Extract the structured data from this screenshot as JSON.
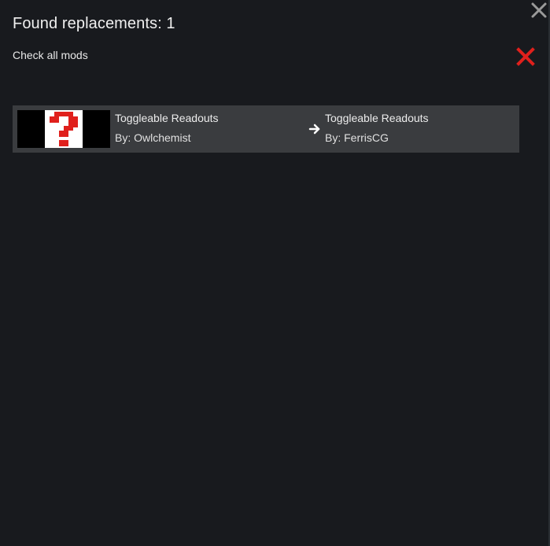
{
  "dialog": {
    "title": "Found replacements: 1",
    "check_all_label": "Check all mods",
    "close_icon": "close-icon",
    "remove_icon": "red-x-icon"
  },
  "replacements": [
    {
      "thumbnail_icon": "missing-image-question-mark",
      "old": {
        "name": "Toggleable Readouts",
        "author": "By: Owlchemist"
      },
      "arrow_icon": "arrow-right-icon",
      "new": {
        "name": "Toggleable Readouts",
        "author": "By: FerrisCG"
      }
    }
  ],
  "colors": {
    "background": "#181a1e",
    "row_background": "#3a3c3f",
    "remove_red": "#e0201c",
    "close_gray": "#9a9a9a"
  }
}
